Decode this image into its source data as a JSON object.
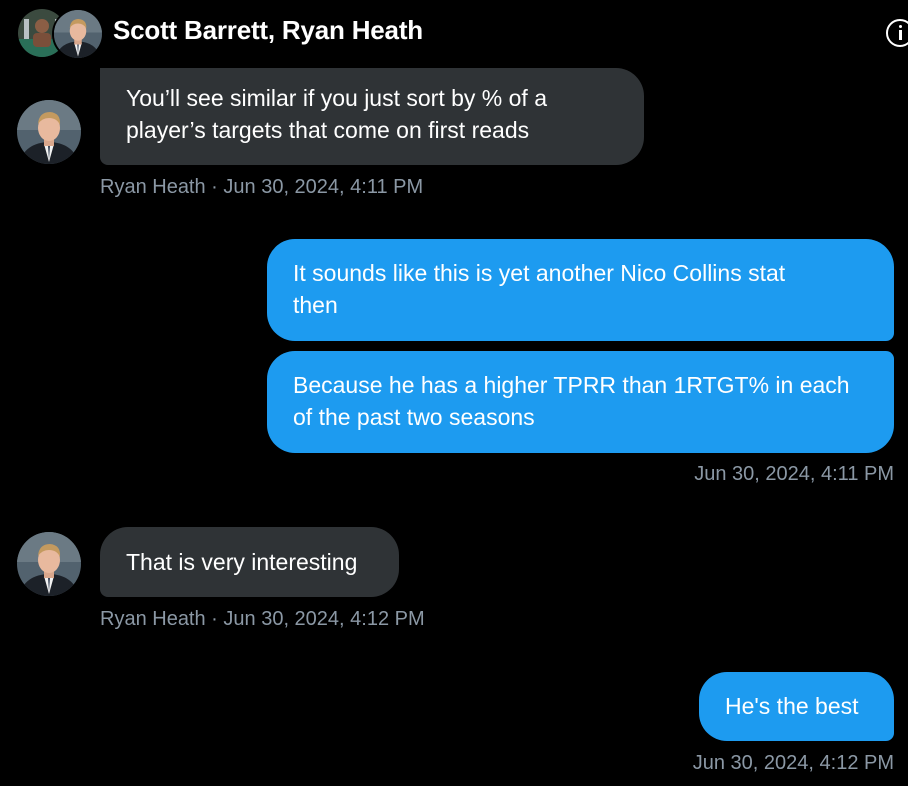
{
  "header": {
    "title": "Scott Barrett, Ryan Heath",
    "info_icon": "info-circle-icon"
  },
  "colors": {
    "background": "#000000",
    "incoming_bubble": "#2f3336",
    "outgoing_bubble": "#1d9bf0",
    "meta_text": "#8b98a5"
  },
  "messages": [
    {
      "direction": "incoming",
      "text_lines": [
        "You’ll see similar if you just sort by % of a",
        "player’s targets that come on first reads"
      ],
      "meta": "Ryan Heath · Jun 30, 2024, 4:11 PM"
    },
    {
      "direction": "outgoing",
      "text_lines": [
        "It sounds like this is yet another Nico Collins stat",
        "then"
      ]
    },
    {
      "direction": "outgoing",
      "text_lines": [
        "Because he has a higher TPRR than 1RTGT% in each",
        "of the past two seasons"
      ],
      "meta": "Jun 30, 2024, 4:11 PM"
    },
    {
      "direction": "incoming",
      "text_lines": [
        "That is very interesting"
      ],
      "meta": "Ryan Heath · Jun 30, 2024, 4:12 PM"
    },
    {
      "direction": "outgoing",
      "text_lines": [
        "He's the best"
      ],
      "meta": "Jun 30, 2024, 4:12 PM"
    }
  ]
}
